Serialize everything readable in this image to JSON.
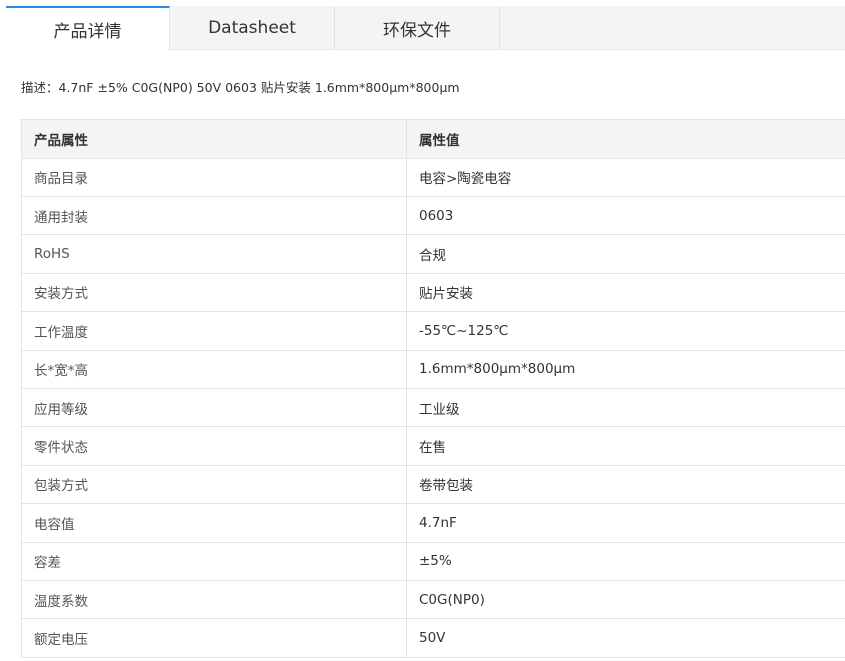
{
  "tabs": [
    {
      "label": "产品详情",
      "active": true
    },
    {
      "label": "Datasheet",
      "active": false
    },
    {
      "label": "环保文件",
      "active": false
    }
  ],
  "description": "描述：4.7nF ±5% C0G(NP0) 50V 0603 贴片安装 1.6mm*800μm*800μm",
  "table": {
    "headers": [
      "产品属性",
      "属性值"
    ],
    "rows": [
      {
        "attr": "商品目录",
        "value": "电容>陶瓷电容"
      },
      {
        "attr": "通用封装",
        "value": "0603"
      },
      {
        "attr": "RoHS",
        "value": "合规"
      },
      {
        "attr": "安装方式",
        "value": "贴片安装"
      },
      {
        "attr": "工作温度",
        "value": "-55℃~125℃"
      },
      {
        "attr": "长*宽*高",
        "value": "1.6mm*800μm*800μm"
      },
      {
        "attr": "应用等级",
        "value": "工业级"
      },
      {
        "attr": "零件状态",
        "value": "在售"
      },
      {
        "attr": "包装方式",
        "value": "卷带包装"
      },
      {
        "attr": "电容值",
        "value": "4.7nF"
      },
      {
        "attr": "容差",
        "value": "±5%"
      },
      {
        "attr": "温度系数",
        "value": "C0G(NP0)"
      },
      {
        "attr": "额定电压",
        "value": "50V"
      }
    ]
  },
  "colors": {
    "active_tab_accent": "#2c8be6",
    "tabbar_bg": "#f4f4f4",
    "border": "#e3e3e3",
    "text": "#333333"
  }
}
